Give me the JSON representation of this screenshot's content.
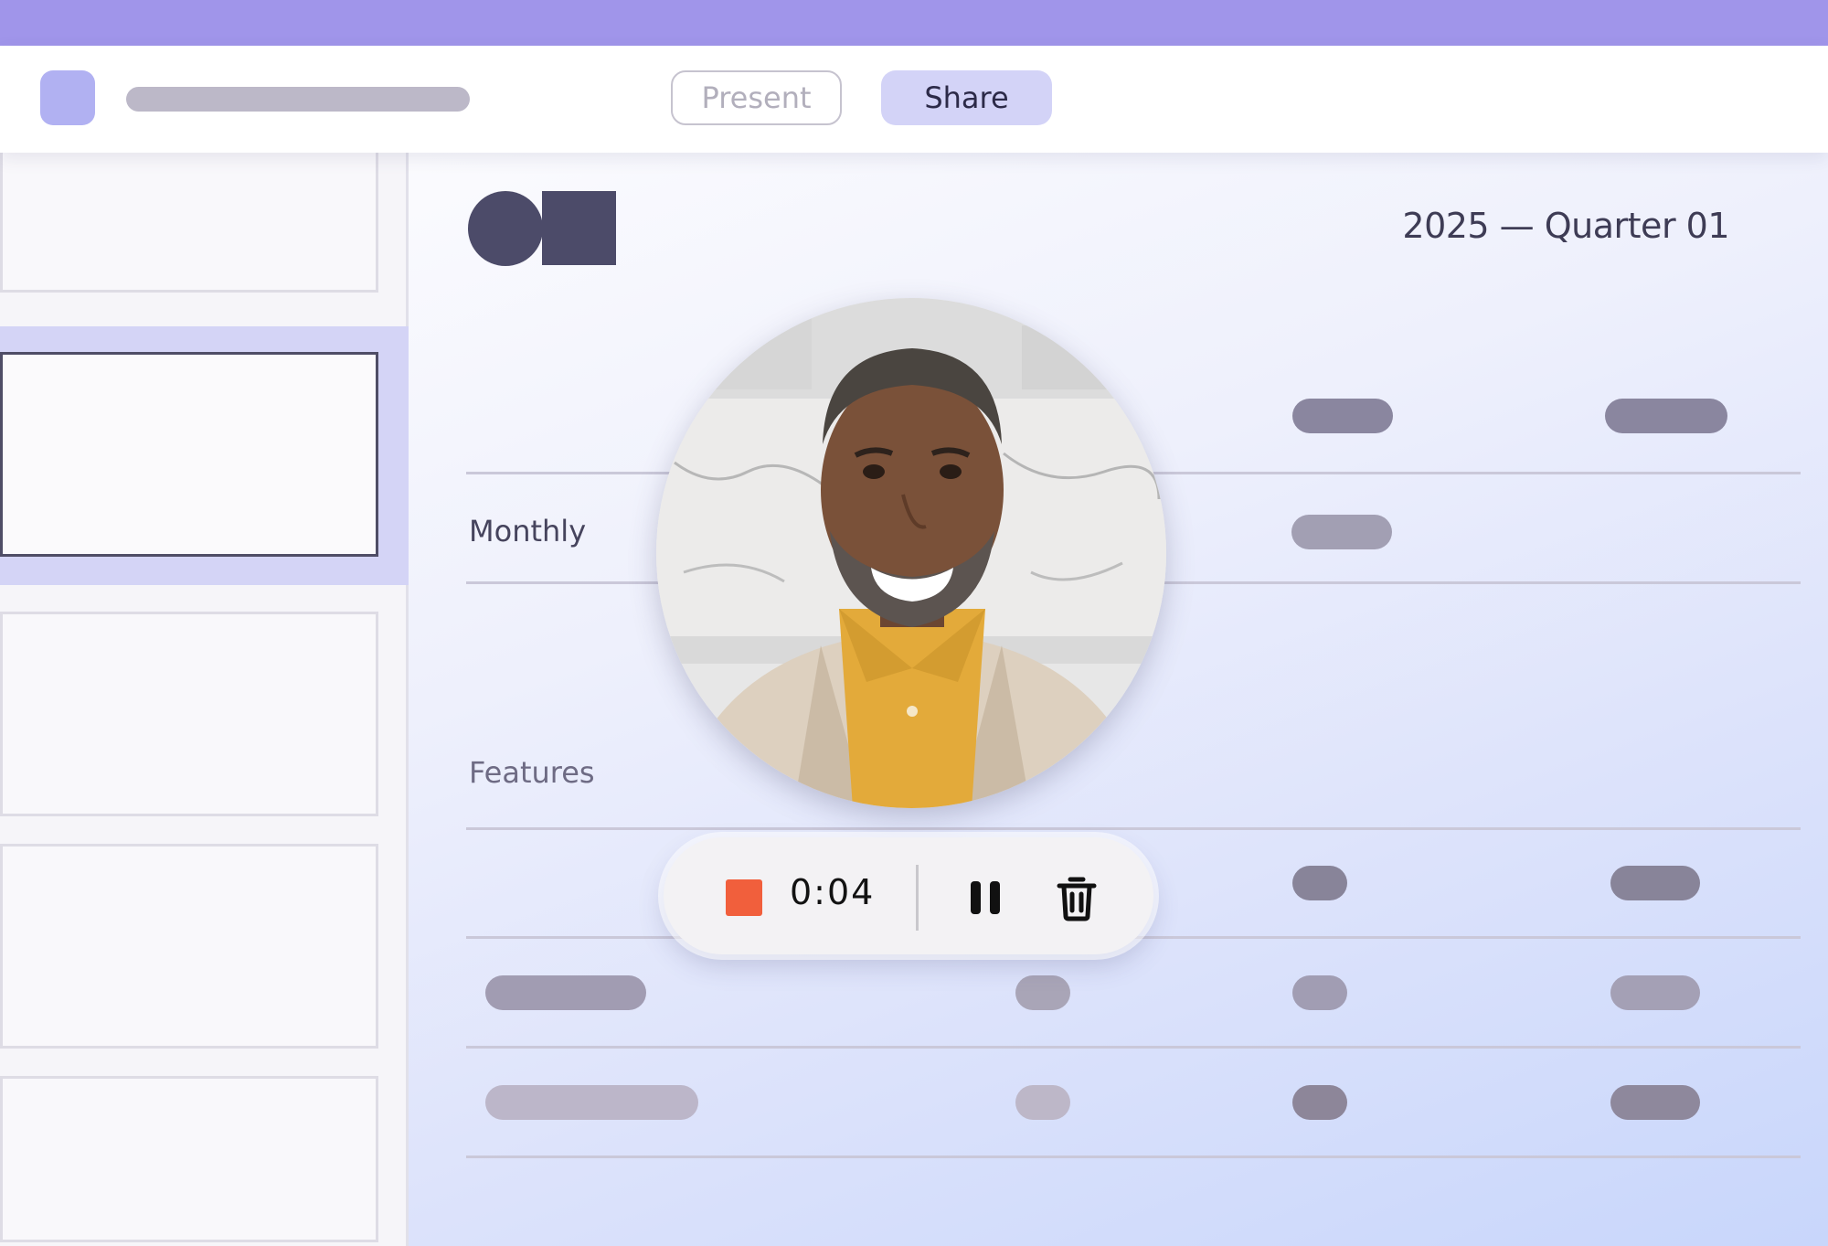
{
  "toolbar": {
    "present_label": "Present",
    "share_label": "Share",
    "app_icon": "app-icon",
    "title_placeholder": "document-title-placeholder"
  },
  "sidebar": {
    "slide_count": 5,
    "selected_index": 2
  },
  "slide": {
    "quarter_title": "2025 — Quarter 01",
    "rows": [
      {
        "label": "Monthly"
      },
      {
        "label": "Features"
      }
    ]
  },
  "recorder": {
    "timer": "0:04",
    "stop_icon": "stop-icon",
    "pause_icon": "pause-icon",
    "delete_icon": "trash-icon"
  },
  "colors": {
    "accent": "#a095ea",
    "share_bg": "#d3d3f7",
    "stop": "#f15f3c",
    "logo": "#4c4b69"
  }
}
